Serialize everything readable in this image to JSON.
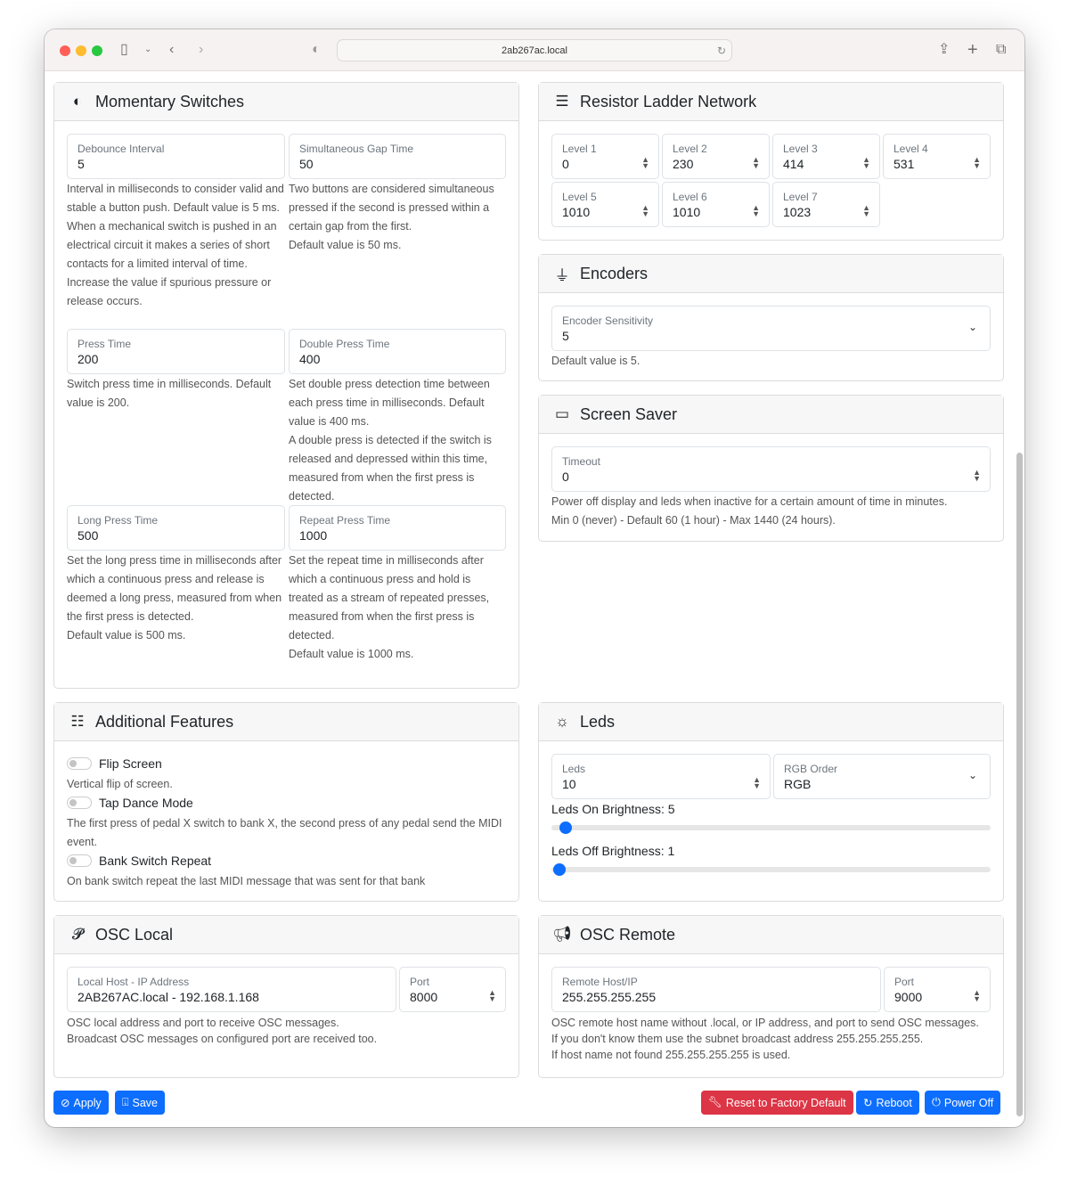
{
  "browser": {
    "url": "2ab267ac.local"
  },
  "momentary": {
    "title": "Momentary Switches",
    "icon": "toggle-icon",
    "fields": [
      {
        "label": "Debounce Interval",
        "value": "5",
        "help": [
          "Interval in milliseconds to consider valid and stable a button push. Default value is 5 ms.",
          "When a mechanical switch is pushed in an electrical circuit it makes a series of short contacts for a limited interval of time.",
          "Increase the value if spurious pressure or release occurs."
        ]
      },
      {
        "label": "Simultaneous Gap Time",
        "value": "50",
        "help": [
          "Two buttons are considered simultaneous pressed if the second is pressed within a certain gap from the first.",
          "Default value is 50 ms."
        ]
      },
      {
        "label": "Press Time",
        "value": "200",
        "help": [
          "Switch press time in milliseconds. Default value is 200."
        ]
      },
      {
        "label": "Double Press Time",
        "value": "400",
        "help": [
          "Set double press detection time between each press time in milliseconds. Default value is 400 ms.",
          "A double press is detected if the switch is released and depressed within this time, measured from when the first press is detected."
        ]
      },
      {
        "label": "Long Press Time",
        "value": "500",
        "help": [
          "Set the long press time in milliseconds after which a continuous press and release is deemed a long press, measured from when the first press is detected.",
          "Default value is 500 ms."
        ]
      },
      {
        "label": "Repeat Press Time",
        "value": "1000",
        "help": [
          "Set the repeat time in milliseconds after which a continuous press and hold is treated as a stream of repeated presses, measured from when the first press is detected.",
          "Default value is 1000 ms."
        ]
      }
    ]
  },
  "ladder": {
    "title": "Resistor Ladder Network",
    "icon": "ladder-icon",
    "levels": [
      {
        "label": "Level 1",
        "value": "0"
      },
      {
        "label": "Level 2",
        "value": "230"
      },
      {
        "label": "Level 3",
        "value": "414"
      },
      {
        "label": "Level 4",
        "value": "531"
      },
      {
        "label": "Level 5",
        "value": "1010"
      },
      {
        "label": "Level 6",
        "value": "1010"
      },
      {
        "label": "Level 7",
        "value": "1023"
      }
    ]
  },
  "encoders": {
    "title": "Encoders",
    "icon": "joystick-icon",
    "label": "Encoder Sensitivity",
    "value": "5",
    "help": "Default value is 5."
  },
  "screensaver": {
    "title": "Screen Saver",
    "icon": "display-icon",
    "label": "Timeout",
    "value": "0",
    "help": [
      "Power off display and leds when inactive for a certain amount of time in minutes.",
      "Min 0 (never) - Default 60 (1 hour) - Max 1440 (24 hours)."
    ]
  },
  "features": {
    "title": "Additional Features",
    "icon": "sliders-icon",
    "items": [
      {
        "label": "Flip Screen",
        "help": "Vertical flip of screen.",
        "on": false
      },
      {
        "label": "Tap Dance Mode",
        "help": "The first press of pedal X switch to bank X, the second press of any pedal send the MIDI event.",
        "on": false
      },
      {
        "label": "Bank Switch Repeat",
        "help": "On bank switch repeat the last MIDI message that was sent for that bank",
        "on": false
      }
    ]
  },
  "leds": {
    "title": "Leds",
    "icon": "sun-icon",
    "count_label": "Leds",
    "count": "10",
    "order_label": "RGB Order",
    "order": "RGB",
    "on_label": "Leds On Brightness: 5",
    "on_value": 5,
    "off_label": "Leds Off Brightness: 1",
    "off_value": 1,
    "max": 255
  },
  "osc_local": {
    "title": "OSC Local",
    "icon": "ear-icon",
    "host_label": "Local Host - IP Address",
    "host": "2AB267AC.local - 192.168.1.168",
    "port_label": "Port",
    "port": "8000",
    "help": [
      "OSC local address and port to receive OSC messages.",
      "Broadcast OSC messages on configured port are received too."
    ]
  },
  "osc_remote": {
    "title": "OSC Remote",
    "icon": "megaphone-icon",
    "host_label": "Remote Host/IP",
    "host": "255.255.255.255",
    "port_label": "Port",
    "port": "9000",
    "help": [
      "OSC remote host name without .local, or IP address, and port to send OSC messages.",
      "If you don't know them use the subnet broadcast address 255.255.255.255.",
      "If host name not found 255.255.255.255 is used."
    ]
  },
  "actions": {
    "apply": "Apply",
    "save": "Save",
    "reset": "Reset to Factory Default",
    "reboot": "Reboot",
    "poweroff": "Power Off"
  },
  "colors": {
    "primary": "#0d6efd",
    "danger": "#dc3545"
  }
}
